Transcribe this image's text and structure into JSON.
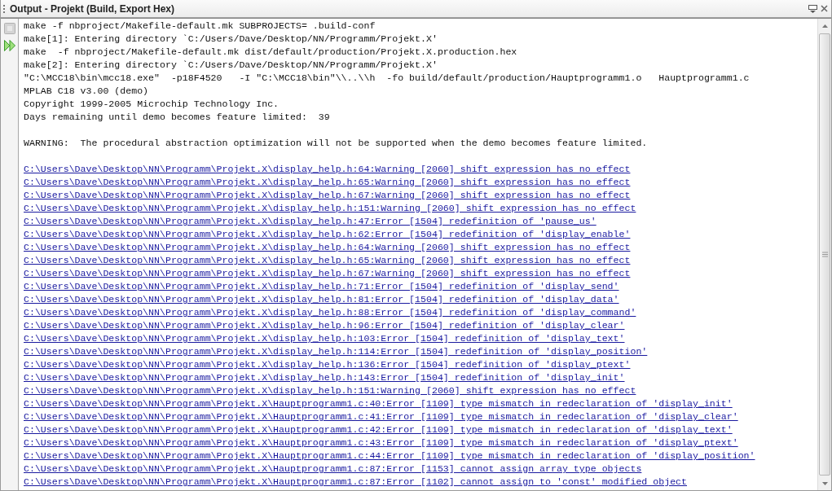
{
  "panel": {
    "title": "Output - Projekt (Build, Export Hex)"
  },
  "toolbar": [
    {
      "kind": "stop",
      "disabled": true
    },
    {
      "kind": "rerun",
      "disabled": false
    }
  ],
  "lines": [
    {
      "kind": "text",
      "text": "make -f nbproject/Makefile-default.mk SUBPROJECTS= .build-conf"
    },
    {
      "kind": "text",
      "text": "make[1]: Entering directory `C:/Users/Dave/Desktop/NN/Programm/Projekt.X'"
    },
    {
      "kind": "text",
      "text": "make  -f nbproject/Makefile-default.mk dist/default/production/Projekt.X.production.hex"
    },
    {
      "kind": "text",
      "text": "make[2]: Entering directory `C:/Users/Dave/Desktop/NN/Programm/Projekt.X'"
    },
    {
      "kind": "text",
      "text": "\"C:\\MCC18\\bin\\mcc18.exe\"  -p18F4520   -I \"C:\\MCC18\\bin\"\\\\..\\\\h  -fo build/default/production/Hauptprogramm1.o   Hauptprogramm1.c"
    },
    {
      "kind": "text",
      "text": "MPLAB C18 v3.00 (demo)"
    },
    {
      "kind": "text",
      "text": "Copyright 1999-2005 Microchip Technology Inc."
    },
    {
      "kind": "text",
      "text": "Days remaining until demo becomes feature limited:  39"
    },
    {
      "kind": "blank"
    },
    {
      "kind": "text",
      "text": "WARNING:  The procedural abstraction optimization will not be supported when the demo becomes feature limited."
    },
    {
      "kind": "blank"
    },
    {
      "kind": "link",
      "text": "C:\\Users\\Dave\\Desktop\\NN\\Programm\\Projekt.X\\display_help.h:64:Warning [2060] shift expression has no effect"
    },
    {
      "kind": "link",
      "text": "C:\\Users\\Dave\\Desktop\\NN\\Programm\\Projekt.X\\display_help.h:65:Warning [2060] shift expression has no effect"
    },
    {
      "kind": "link",
      "text": "C:\\Users\\Dave\\Desktop\\NN\\Programm\\Projekt.X\\display_help.h:67:Warning [2060] shift expression has no effect"
    },
    {
      "kind": "link",
      "text": "C:\\Users\\Dave\\Desktop\\NN\\Programm\\Projekt.X\\display_help.h:151:Warning [2060] shift expression has no effect"
    },
    {
      "kind": "link",
      "text": "C:\\Users\\Dave\\Desktop\\NN\\Programm\\Projekt.X\\display_help.h:47:Error [1504] redefinition of 'pause_us'"
    },
    {
      "kind": "link",
      "text": "C:\\Users\\Dave\\Desktop\\NN\\Programm\\Projekt.X\\display_help.h:62:Error [1504] redefinition of 'display_enable'"
    },
    {
      "kind": "link",
      "text": "C:\\Users\\Dave\\Desktop\\NN\\Programm\\Projekt.X\\display_help.h:64:Warning [2060] shift expression has no effect"
    },
    {
      "kind": "link",
      "text": "C:\\Users\\Dave\\Desktop\\NN\\Programm\\Projekt.X\\display_help.h:65:Warning [2060] shift expression has no effect"
    },
    {
      "kind": "link",
      "text": "C:\\Users\\Dave\\Desktop\\NN\\Programm\\Projekt.X\\display_help.h:67:Warning [2060] shift expression has no effect"
    },
    {
      "kind": "link",
      "text": "C:\\Users\\Dave\\Desktop\\NN\\Programm\\Projekt.X\\display_help.h:71:Error [1504] redefinition of 'display_send'"
    },
    {
      "kind": "link",
      "text": "C:\\Users\\Dave\\Desktop\\NN\\Programm\\Projekt.X\\display_help.h:81:Error [1504] redefinition of 'display_data'"
    },
    {
      "kind": "link",
      "text": "C:\\Users\\Dave\\Desktop\\NN\\Programm\\Projekt.X\\display_help.h:88:Error [1504] redefinition of 'display_command'"
    },
    {
      "kind": "link",
      "text": "C:\\Users\\Dave\\Desktop\\NN\\Programm\\Projekt.X\\display_help.h:96:Error [1504] redefinition of 'display_clear'"
    },
    {
      "kind": "link",
      "text": "C:\\Users\\Dave\\Desktop\\NN\\Programm\\Projekt.X\\display_help.h:103:Error [1504] redefinition of 'display_text'"
    },
    {
      "kind": "link",
      "text": "C:\\Users\\Dave\\Desktop\\NN\\Programm\\Projekt.X\\display_help.h:114:Error [1504] redefinition of 'display_position'"
    },
    {
      "kind": "link",
      "text": "C:\\Users\\Dave\\Desktop\\NN\\Programm\\Projekt.X\\display_help.h:136:Error [1504] redefinition of 'display_ptext'"
    },
    {
      "kind": "link",
      "text": "C:\\Users\\Dave\\Desktop\\NN\\Programm\\Projekt.X\\display_help.h:143:Error [1504] redefinition of 'display_init'"
    },
    {
      "kind": "link",
      "text": "C:\\Users\\Dave\\Desktop\\NN\\Programm\\Projekt.X\\display_help.h:151:Warning [2060] shift expression has no effect"
    },
    {
      "kind": "link",
      "text": "C:\\Users\\Dave\\Desktop\\NN\\Programm\\Projekt.X\\Hauptprogramm1.c:40:Error [1109] type mismatch in redeclaration of 'display_init'"
    },
    {
      "kind": "link",
      "text": "C:\\Users\\Dave\\Desktop\\NN\\Programm\\Projekt.X\\Hauptprogramm1.c:41:Error [1109] type mismatch in redeclaration of 'display_clear'"
    },
    {
      "kind": "link",
      "text": "C:\\Users\\Dave\\Desktop\\NN\\Programm\\Projekt.X\\Hauptprogramm1.c:42:Error [1109] type mismatch in redeclaration of 'display_text'"
    },
    {
      "kind": "link",
      "text": "C:\\Users\\Dave\\Desktop\\NN\\Programm\\Projekt.X\\Hauptprogramm1.c:43:Error [1109] type mismatch in redeclaration of 'display_ptext'"
    },
    {
      "kind": "link",
      "text": "C:\\Users\\Dave\\Desktop\\NN\\Programm\\Projekt.X\\Hauptprogramm1.c:44:Error [1109] type mismatch in redeclaration of 'display_position'"
    },
    {
      "kind": "link",
      "text": "C:\\Users\\Dave\\Desktop\\NN\\Programm\\Projekt.X\\Hauptprogramm1.c:87:Error [1153] cannot assign array type objects"
    },
    {
      "kind": "link",
      "text": "C:\\Users\\Dave\\Desktop\\NN\\Programm\\Projekt.X\\Hauptprogramm1.c:87:Error [1102] cannot assign to 'const' modified object"
    }
  ]
}
